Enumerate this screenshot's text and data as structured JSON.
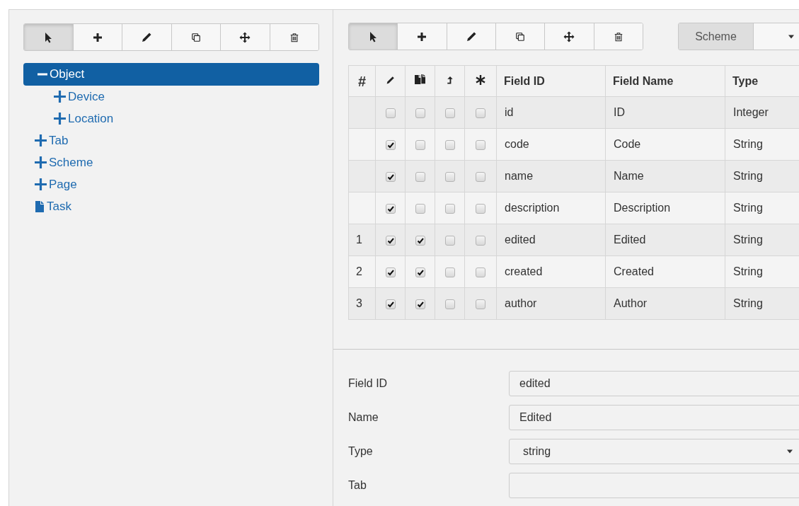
{
  "left_toolbar": [
    {
      "kind": "pointer",
      "selected": true
    },
    {
      "kind": "add",
      "selected": false
    },
    {
      "kind": "edit",
      "selected": false
    },
    {
      "kind": "copy",
      "selected": false
    },
    {
      "kind": "move",
      "selected": false
    },
    {
      "kind": "delete",
      "selected": false
    }
  ],
  "tree": [
    {
      "label": "Object",
      "kind": "folder",
      "expanded": true,
      "selected": true,
      "children": [
        {
          "label": "Device",
          "kind": "folder",
          "expanded": false,
          "selected": false
        },
        {
          "label": "Location",
          "kind": "folder",
          "expanded": false,
          "selected": false
        }
      ]
    },
    {
      "label": "Tab",
      "kind": "folder",
      "expanded": false,
      "selected": false
    },
    {
      "label": "Scheme",
      "kind": "folder",
      "expanded": false,
      "selected": false
    },
    {
      "label": "Page",
      "kind": "folder",
      "expanded": false,
      "selected": false
    },
    {
      "label": "Task",
      "kind": "file",
      "selected": false
    }
  ],
  "right_toolbar": [
    {
      "kind": "pointer",
      "selected": true
    },
    {
      "kind": "add",
      "selected": false
    },
    {
      "kind": "edit",
      "selected": false
    },
    {
      "kind": "copy",
      "selected": false
    },
    {
      "kind": "move",
      "selected": false
    },
    {
      "kind": "delete",
      "selected": false
    }
  ],
  "scheme_selector": {
    "label": "Scheme"
  },
  "table": {
    "columns": [
      {
        "kind": "text",
        "label": "#"
      },
      {
        "kind": "icon"
      },
      {
        "kind": "icon"
      },
      {
        "kind": "icon"
      },
      {
        "kind": "icon"
      },
      {
        "kind": "text",
        "label": "Field ID"
      },
      {
        "kind": "text",
        "label": "Field Name"
      },
      {
        "kind": "text",
        "label": "Type"
      }
    ],
    "rows": [
      {
        "checks": [
          false,
          false,
          false,
          false
        ],
        "field_id": "id",
        "field_name": "ID",
        "type": "Integer"
      },
      {
        "checks": [
          true,
          false,
          false,
          false
        ],
        "field_id": "code",
        "field_name": "Code",
        "type": "String"
      },
      {
        "checks": [
          true,
          false,
          false,
          false
        ],
        "field_id": "name",
        "field_name": "Name",
        "type": "String"
      },
      {
        "checks": [
          true,
          false,
          false,
          false
        ],
        "field_id": "description",
        "field_name": "Description",
        "type": "String"
      },
      {
        "order": "1",
        "checks": [
          true,
          true,
          false,
          false
        ],
        "field_id": "edited",
        "field_name": "Edited",
        "type": "String"
      },
      {
        "order": "2",
        "checks": [
          true,
          true,
          false,
          false
        ],
        "field_id": "created",
        "field_name": "Created",
        "type": "String"
      },
      {
        "order": "3",
        "checks": [
          true,
          true,
          false,
          false
        ],
        "field_id": "author",
        "field_name": "Author",
        "type": "String"
      }
    ]
  },
  "form": [
    {
      "label": "Field ID",
      "kind": "text",
      "value": "edited"
    },
    {
      "label": "Name",
      "kind": "text",
      "value": "Edited"
    },
    {
      "label": "Type",
      "kind": "select",
      "value": "string"
    },
    {
      "label": "Tab",
      "kind": "text"
    }
  ]
}
